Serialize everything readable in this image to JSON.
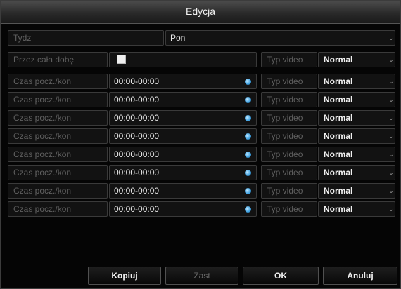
{
  "dialog": {
    "title": "Edycja"
  },
  "week": {
    "label": "Tydz",
    "value": "Pon"
  },
  "all_day": {
    "label": "Przez cała dobę",
    "checked": true,
    "video_type_label": "Typ video",
    "video_type_value": "Normal"
  },
  "schedule_rows": [
    {
      "label": "Czas pocz./kon",
      "time": "00:00-00:00",
      "video_type_label": "Typ video",
      "video_type_value": "Normal"
    },
    {
      "label": "Czas pocz./kon",
      "time": "00:00-00:00",
      "video_type_label": "Typ video",
      "video_type_value": "Normal"
    },
    {
      "label": "Czas pocz./kon",
      "time": "00:00-00:00",
      "video_type_label": "Typ video",
      "video_type_value": "Normal"
    },
    {
      "label": "Czas pocz./kon",
      "time": "00:00-00:00",
      "video_type_label": "Typ video",
      "video_type_value": "Normal"
    },
    {
      "label": "Czas pocz./kon",
      "time": "00:00-00:00",
      "video_type_label": "Typ video",
      "video_type_value": "Normal"
    },
    {
      "label": "Czas pocz./kon",
      "time": "00:00-00:00",
      "video_type_label": "Typ video",
      "video_type_value": "Normal"
    },
    {
      "label": "Czas pocz./kon",
      "time": "00:00-00:00",
      "video_type_label": "Typ video",
      "video_type_value": "Normal"
    },
    {
      "label": "Czas pocz./kon",
      "time": "00:00-00:00",
      "video_type_label": "Typ video",
      "video_type_value": "Normal"
    }
  ],
  "buttons": {
    "copy": "Kopiuj",
    "apply": "Zast",
    "ok": "OK",
    "cancel": "Anuluj"
  },
  "icons": {
    "clock": "clock-icon",
    "dropdown": "chevron-down-icon",
    "checkbox": "checkbox"
  },
  "colors": {
    "accent_clock": "#3b9fe0",
    "background": "#050505",
    "title_bar": "#2a2a2a"
  }
}
